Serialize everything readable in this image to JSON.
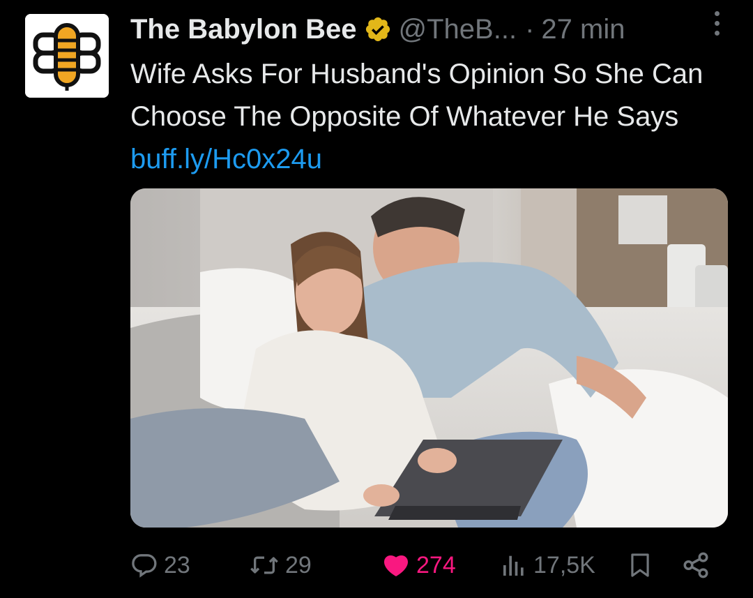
{
  "tweet": {
    "author_name": "The Babylon Bee",
    "handle": "@TheB...",
    "separator": "·",
    "time": "27 min",
    "text": "Wife Asks For Husband's Opinion So She Can Choose The Opposite Of Whatever He Says",
    "link": "buff.ly/Hc0x24u",
    "verified_badge": "gold-verified-badge",
    "media_alt": "photo of a smiling couple on a sofa looking at a laptop"
  },
  "actions": {
    "replies": "23",
    "reposts": "29",
    "likes": "274",
    "views": "17,5K"
  },
  "colors": {
    "background": "#000000",
    "text": "#e7e9ea",
    "muted": "#71767b",
    "link": "#1d9bf0",
    "like": "#f91880",
    "badge": "#e2b719"
  }
}
